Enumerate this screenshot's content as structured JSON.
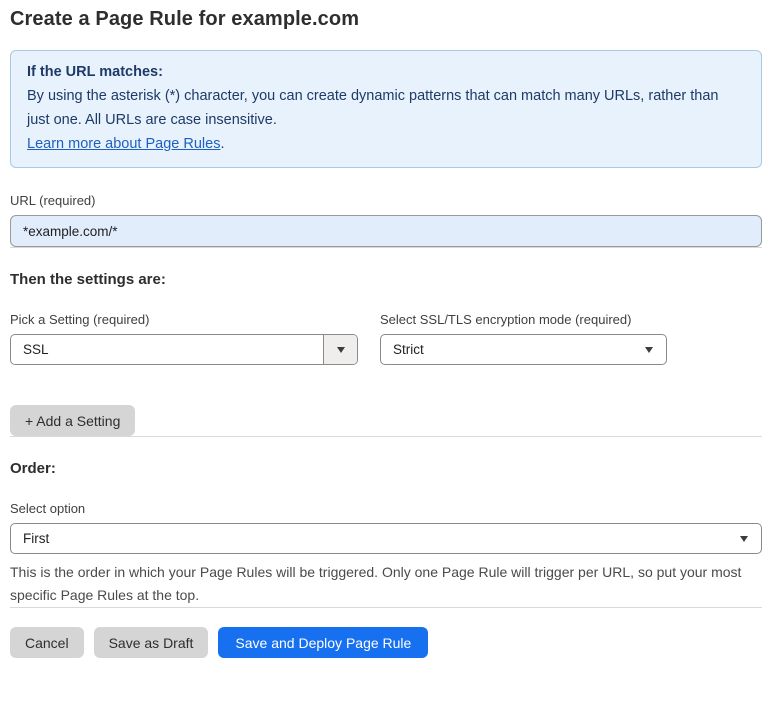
{
  "page": {
    "title": "Create a Page Rule for example.com"
  },
  "info_box": {
    "heading": "If the URL matches:",
    "body": "By using the asterisk (*) character, you can create dynamic patterns that can match many URLs, rather than just one. All URLs are case insensitive.",
    "link": "Learn more about Page Rules",
    "link_suffix": "."
  },
  "url_field": {
    "label": "URL (required)",
    "value": "*example.com/*"
  },
  "settings": {
    "heading": "Then the settings are:",
    "setting_select": {
      "label": "Pick a Setting (required)",
      "value": "SSL"
    },
    "mode_select": {
      "label": "Select SSL/TLS encryption mode (required)",
      "value": "Strict"
    },
    "add_button": "+ Add a Setting"
  },
  "order": {
    "heading": "Order:",
    "select_label": "Select option",
    "value": "First",
    "help_text": "This is the order in which your Page Rules will be triggered. Only one Page Rule will trigger per URL, so put your most specific Page Rules at the top."
  },
  "footer": {
    "cancel": "Cancel",
    "save_draft": "Save as Draft",
    "save_deploy": "Save and Deploy Page Rule"
  },
  "colors": {
    "primary_blue": "#1670f0",
    "info_bg": "#e8f2fc",
    "info_border": "#a9c9e9",
    "info_text": "#1e3a68",
    "link_blue": "#1d5fc2",
    "input_bg": "#e1edfb",
    "gray_btn": "#d5d5d5",
    "divider": "#d9d9d9"
  }
}
